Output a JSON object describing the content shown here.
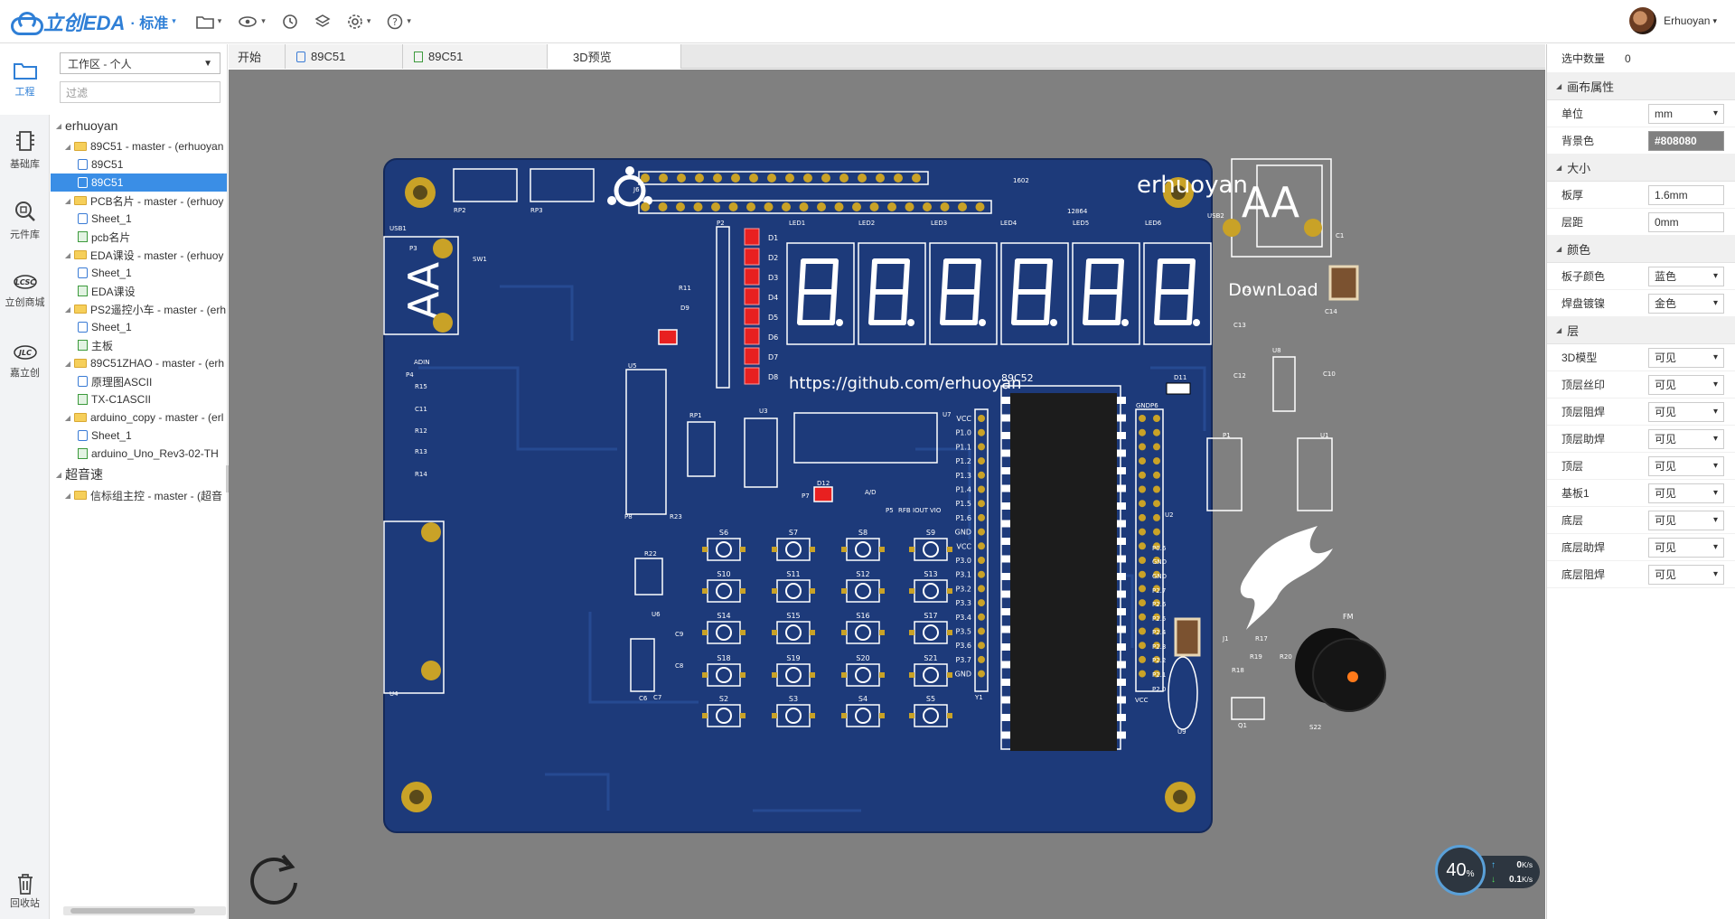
{
  "app": {
    "logo_name": "立创EDA",
    "logo_edition": "· 标准",
    "user_name": "Erhuoyan"
  },
  "toolbar": {
    "icons": [
      "folder-icon",
      "eye-icon",
      "history-icon",
      "layers-icon",
      "gear-icon",
      "help-icon"
    ]
  },
  "rail": {
    "items": [
      {
        "label": "工程",
        "icon": "folder-icon"
      },
      {
        "label": "基础库",
        "icon": "chip-icon"
      },
      {
        "label": "元件库",
        "icon": "component-search-icon"
      },
      {
        "label": "立创商城",
        "icon": "lcsc-logo-icon"
      },
      {
        "label": "嘉立创",
        "icon": "jlc-logo-icon"
      }
    ],
    "trash_label": "回收站"
  },
  "project": {
    "workspace": "工作区 - 个人",
    "filter_placeholder": "过滤",
    "tree": [
      {
        "text": "erhuoyan",
        "type": "root",
        "level": 0
      },
      {
        "text": "89C51 - master - (erhuoyan",
        "type": "folder",
        "level": 1
      },
      {
        "text": "89C51",
        "type": "sheet",
        "level": 2
      },
      {
        "text": "89C51",
        "type": "sheet",
        "level": 2,
        "selected": true
      },
      {
        "text": "PCB名片 - master - (erhuoy",
        "type": "folder",
        "level": 1
      },
      {
        "text": "Sheet_1",
        "type": "sheet",
        "level": 2
      },
      {
        "text": "pcb名片",
        "type": "pcb",
        "level": 2
      },
      {
        "text": "EDA课设 - master - (erhuoy",
        "type": "folder",
        "level": 1
      },
      {
        "text": "Sheet_1",
        "type": "sheet",
        "level": 2
      },
      {
        "text": "EDA课设",
        "type": "pcb",
        "level": 2
      },
      {
        "text": "PS2遥控小车 - master - (erh",
        "type": "folder",
        "level": 1
      },
      {
        "text": "Sheet_1",
        "type": "sheet",
        "level": 2
      },
      {
        "text": "主板",
        "type": "pcb",
        "level": 2
      },
      {
        "text": "89C51ZHAO - master - (erh",
        "type": "folder",
        "level": 1
      },
      {
        "text": "原理图ASCII",
        "type": "sheet",
        "level": 2
      },
      {
        "text": "TX-C1ASCII",
        "type": "pcb",
        "level": 2
      },
      {
        "text": "arduino_copy - master - (erl",
        "type": "folder",
        "level": 1
      },
      {
        "text": "Sheet_1",
        "type": "sheet",
        "level": 2
      },
      {
        "text": "arduino_Uno_Rev3-02-TH",
        "type": "pcb",
        "level": 2
      },
      {
        "text": "超音速",
        "type": "root",
        "level": 0
      },
      {
        "text": "信标组主控 - master - (超音",
        "type": "folder",
        "level": 1
      }
    ]
  },
  "tabs": [
    {
      "label": "开始",
      "icon": ""
    },
    {
      "label": "89C51",
      "icon": "sheet"
    },
    {
      "label": "89C51",
      "icon": "pcb"
    },
    {
      "label": "3D预览",
      "icon": "",
      "active": true
    }
  ],
  "canvas": {
    "background": "#808080",
    "board_color": "#1d3a7a",
    "pad_color": "#c9a227",
    "board_title": "erhuoyan",
    "board_url": "https://github.com/erhuoyan",
    "download_label": "DownLoad",
    "mcu_label": "89C52",
    "buzzer_label": "FM",
    "zoom_percent": "40",
    "zoom_unit": "%",
    "upload_speed": "0",
    "download_speed": "0.1",
    "speed_unit": "K/s",
    "silk_labels": [
      "RP2",
      "RP3",
      "J6",
      "1602",
      "12864",
      "USB1",
      "SW1",
      "P2",
      "R11",
      "D9",
      "LED1",
      "LED2",
      "LED3",
      "LED4",
      "LED5",
      "LED6",
      "USB2",
      "Y3",
      "C1",
      "U8",
      "C13",
      "C12",
      "C14",
      "C10",
      "D11",
      "ADIN",
      "P4",
      "U5",
      "R15",
      "C11",
      "R12",
      "R13",
      "R14",
      "RP1",
      "U3",
      "U7",
      "P7",
      "D12",
      "A/D",
      "P5",
      "RFB",
      "IOUT",
      "VIO",
      "GND",
      "P6",
      "P1",
      "U1",
      "U2",
      "P0.6",
      "GND",
      "GND",
      "P2.7",
      "P2.6",
      "P2.5",
      "P2.4",
      "P2.3",
      "P2.2",
      "P2.1",
      "P2.0",
      "VCC",
      "P8",
      "R23",
      "R22",
      "U6",
      "C9",
      "C8",
      "C7",
      "C6",
      "U4",
      "J1",
      "R17",
      "R18",
      "R19",
      "R20",
      "Q1",
      "S22",
      "U9",
      "Y1",
      "P3"
    ],
    "led_marks": [
      "D1",
      "D2",
      "D3",
      "D4",
      "D5",
      "D6",
      "D7",
      "D8"
    ],
    "p7_pins": [
      "VCC",
      "P1.0",
      "P1.1",
      "P1.2",
      "P1.3",
      "P1.4",
      "P1.5",
      "P1.6",
      "GND",
      "VCC",
      "P3.0",
      "P3.1",
      "P3.2",
      "P3.3",
      "P3.4",
      "P3.5",
      "P3.6",
      "P3.7",
      "GND"
    ],
    "buttons": [
      "S6",
      "S7",
      "S8",
      "S9",
      "S10",
      "S11",
      "S12",
      "S13",
      "S14",
      "S15",
      "S16",
      "S17",
      "S18",
      "S19",
      "S20",
      "S21",
      "S2",
      "S3",
      "S4",
      "S5"
    ]
  },
  "props": {
    "selected_count_label": "选中数量",
    "selected_count": "0",
    "sections": [
      {
        "title": "画布属性",
        "rows": [
          {
            "label": "单位",
            "value": "mm",
            "kind": "dd"
          },
          {
            "label": "背景色",
            "value": "#808080",
            "kind": "color"
          }
        ]
      },
      {
        "title": "大小",
        "rows": [
          {
            "label": "板厚",
            "value": "1.6mm",
            "kind": "text"
          },
          {
            "label": "层距",
            "value": "0mm",
            "kind": "text"
          }
        ]
      },
      {
        "title": "颜色",
        "rows": [
          {
            "label": "板子颜色",
            "value": "蓝色",
            "kind": "dd"
          },
          {
            "label": "焊盘镀镍",
            "value": "金色",
            "kind": "dd"
          }
        ]
      },
      {
        "title": "层",
        "rows": [
          {
            "label": "3D模型",
            "value": "可见",
            "kind": "dd"
          },
          {
            "label": "顶层丝印",
            "value": "可见",
            "kind": "dd"
          },
          {
            "label": "顶层阻焊",
            "value": "可见",
            "kind": "dd"
          },
          {
            "label": "顶层助焊",
            "value": "可见",
            "kind": "dd"
          },
          {
            "label": "顶层",
            "value": "可见",
            "kind": "dd"
          },
          {
            "label": "基板1",
            "value": "可见",
            "kind": "dd"
          },
          {
            "label": "底层",
            "value": "可见",
            "kind": "dd"
          },
          {
            "label": "底层助焊",
            "value": "可见",
            "kind": "dd"
          },
          {
            "label": "底层阻焊",
            "value": "可见",
            "kind": "dd"
          }
        ]
      }
    ]
  }
}
